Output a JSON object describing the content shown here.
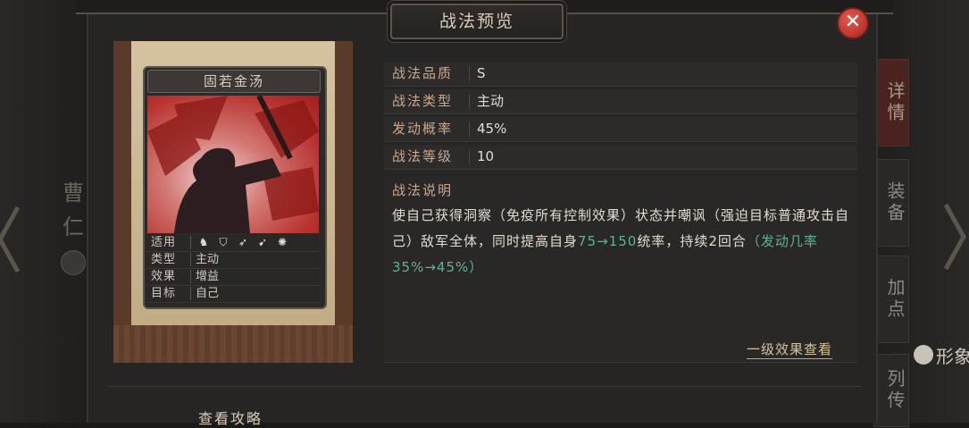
{
  "background": {
    "left_glyphs": [
      "曹",
      "仁"
    ],
    "side_tabs": [
      {
        "label": "详情",
        "active": true
      },
      {
        "label": "装备",
        "active": false
      },
      {
        "label": "加点",
        "active": false
      },
      {
        "label": "列传",
        "active": false
      }
    ],
    "figure_label": "形象"
  },
  "modal": {
    "title": "战法预览",
    "close_icon": "close-icon"
  },
  "card": {
    "name": "固若金汤",
    "info": [
      {
        "key": "适用",
        "value": ""
      },
      {
        "key": "类型",
        "value": "主动"
      },
      {
        "key": "效果",
        "value": "增益"
      },
      {
        "key": "目标",
        "value": "自己"
      }
    ],
    "unit_icons": [
      "cavalry-icon",
      "shield-icon",
      "archer-icon",
      "spear-icon",
      "siege-icon"
    ]
  },
  "fields": [
    {
      "label": "战法品质",
      "value": "S"
    },
    {
      "label": "战法类型",
      "value": "主动"
    },
    {
      "label": "发动概率",
      "value": "45%"
    },
    {
      "label": "战法等级",
      "value": "10"
    }
  ],
  "description": {
    "label": "战法说明",
    "text_part1": "使自己获得洞察（免疫所有控制效果）状态并嘲讽（强迫目标普通攻击自己）敌军全体，同时提高自身",
    "highlight1": "75→150",
    "text_part2": "统率，持续2回合",
    "highlight2": "（发动几率35%→45%）"
  },
  "links": {
    "level_one_effect": "一级效果查看",
    "strategy_guide": "查看攻略"
  },
  "colors": {
    "accent_red": "#b8332f",
    "highlight_green": "#5fb29a",
    "label_tan": "#c9a890"
  }
}
